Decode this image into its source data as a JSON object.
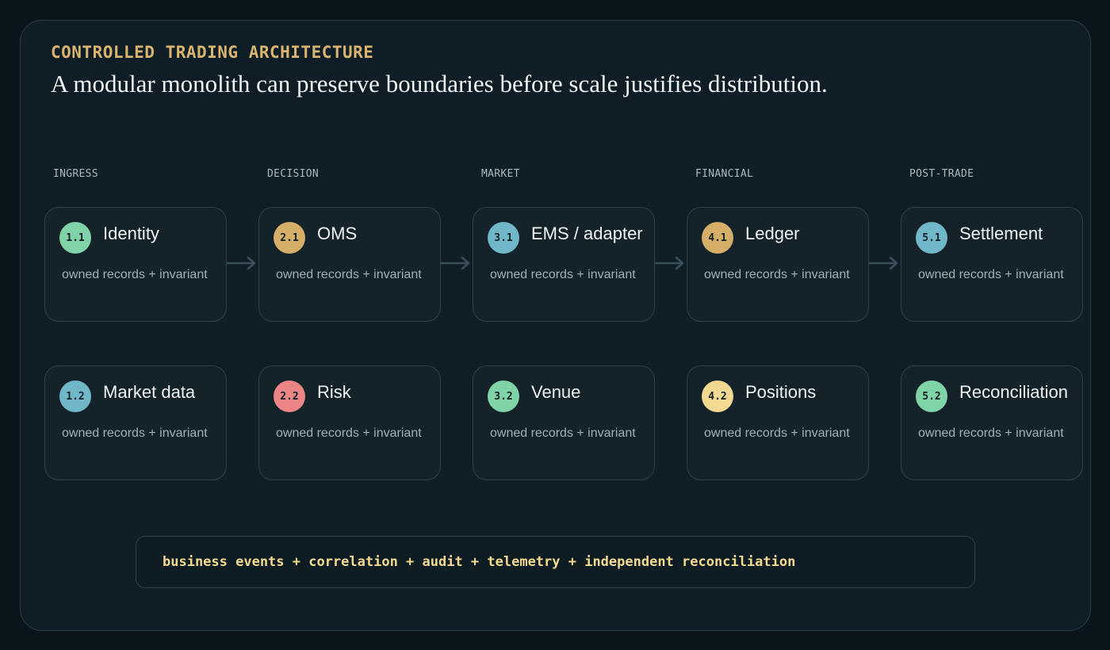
{
  "header": {
    "eyebrow": "CONTROLLED TRADING ARCHITECTURE",
    "headline": "A modular monolith can preserve boundaries before scale justifies distribution."
  },
  "columns": [
    {
      "label": "INGRESS",
      "cards": [
        {
          "id": "1.1",
          "title": "Identity",
          "subtitle": "owned records + invariant",
          "color": "#7fd3a6"
        },
        {
          "id": "1.2",
          "title": "Market data",
          "subtitle": "owned records + invariant",
          "color": "#6fb7c9"
        }
      ]
    },
    {
      "label": "DECISION",
      "cards": [
        {
          "id": "2.1",
          "title": "OMS",
          "subtitle": "owned records + invariant",
          "color": "#d5ae67"
        },
        {
          "id": "2.2",
          "title": "Risk",
          "subtitle": "owned records + invariant",
          "color": "#ec8585"
        }
      ]
    },
    {
      "label": "MARKET",
      "cards": [
        {
          "id": "3.1",
          "title": "EMS / adapter",
          "subtitle": "owned records + invariant",
          "color": "#6fb7c9"
        },
        {
          "id": "3.2",
          "title": "Venue",
          "subtitle": "owned records + invariant",
          "color": "#7fd3a6"
        }
      ]
    },
    {
      "label": "FINANCIAL",
      "cards": [
        {
          "id": "4.1",
          "title": "Ledger",
          "subtitle": "owned records + invariant",
          "color": "#d5ae67"
        },
        {
          "id": "4.2",
          "title": "Positions",
          "subtitle": "owned records + invariant",
          "color": "#f3d992"
        }
      ]
    },
    {
      "label": "POST-TRADE",
      "cards": [
        {
          "id": "5.1",
          "title": "Settlement",
          "subtitle": "owned records + invariant",
          "color": "#6fb7c9"
        },
        {
          "id": "5.2",
          "title": "Reconciliation",
          "subtitle": "owned records + invariant",
          "color": "#7fd3a6"
        }
      ]
    }
  ],
  "footer": {
    "text": "business events + correlation + audit + telemetry + independent reconciliation"
  },
  "colors": {
    "accent": "#d9b46e",
    "footer_text": "#f4d98f",
    "arrow": "#3b5058"
  }
}
